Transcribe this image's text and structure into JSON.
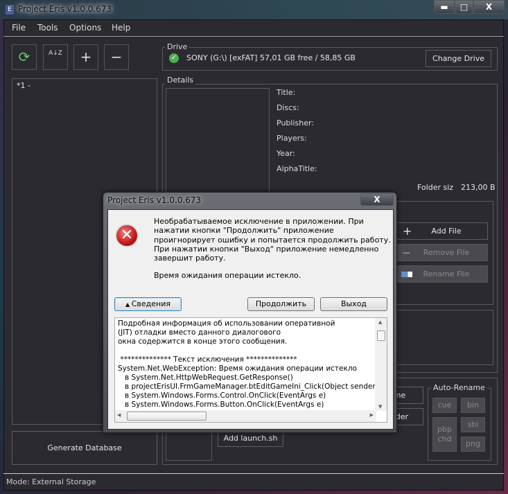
{
  "window": {
    "title": "Project Eris v1.0.0.673",
    "minimize": "▬",
    "maximize": "□",
    "close": "X"
  },
  "menu": [
    "File",
    "Tools",
    "Options",
    "Help"
  ],
  "toolbar": {
    "refresh": "⟳",
    "sort": "A↓Z",
    "add": "+",
    "remove": "−"
  },
  "drive": {
    "label": "Drive",
    "info": "SONY (G:\\) [exFAT] 57,01 GB free / 58,85 GB",
    "change_button": "Change Drive",
    "status_color": "#4caf50"
  },
  "game_list": [
    "*1 -"
  ],
  "details": {
    "label": "Details",
    "fields": [
      "Title:",
      "Discs:",
      "Publisher:",
      "Players:",
      "Year:",
      "AlphaTitle:"
    ],
    "folder_size_label": "Folder siz",
    "folder_size_value": "213,00 B"
  },
  "files": {
    "add": "Add File",
    "remove": "Remove File",
    "rename": "Rename File"
  },
  "bottom": {
    "rename_partial": "ame",
    "folder_partial": "older",
    "add_launch": "Add launch.sh",
    "generate": "Generate Database"
  },
  "auto_rename": {
    "label": "Auto-Rename",
    "cue": "cue",
    "bin": "bin",
    "pbp": "pbp",
    "chd": "chd",
    "sbi": "sbi",
    "png": "png"
  },
  "status": "Mode: External Storage",
  "dialog": {
    "title": "Project Eris v1.0.0.673",
    "close": "X",
    "message": [
      "Необрабатываемое исключение в приложении. При",
      "нажатии кнопки \"Продолжить\" приложение",
      "проигнорирует ошибку и попытается продолжить работу.",
      "При нажатии кнопки \"Выход\" приложение немедленно",
      "завершит работу."
    ],
    "error": "Время ожидания операции истекло.",
    "details_button": "Сведения",
    "continue_button": "Продолжить",
    "exit_button": "Выход",
    "details_lines": [
      "Подробная информация об использовании оперативной",
      "(JIT) отладки вместо данного диалогового",
      "окна содержится в конце этого сообщения.",
      "",
      " ************** Текст исключения **************",
      "System.Net.WebException: Время ожидания операции истекло",
      "   в System.Net.HttpWebRequest.GetResponse()",
      "   в projectErisUI.FrmGameManager.btEditGameIni_Click(Object sender, EventArgs e)",
      "   в System.Windows.Forms.Control.OnClick(EventArgs e)",
      "   в System.Windows.Forms.Button.OnClick(EventArgs e)"
    ]
  }
}
